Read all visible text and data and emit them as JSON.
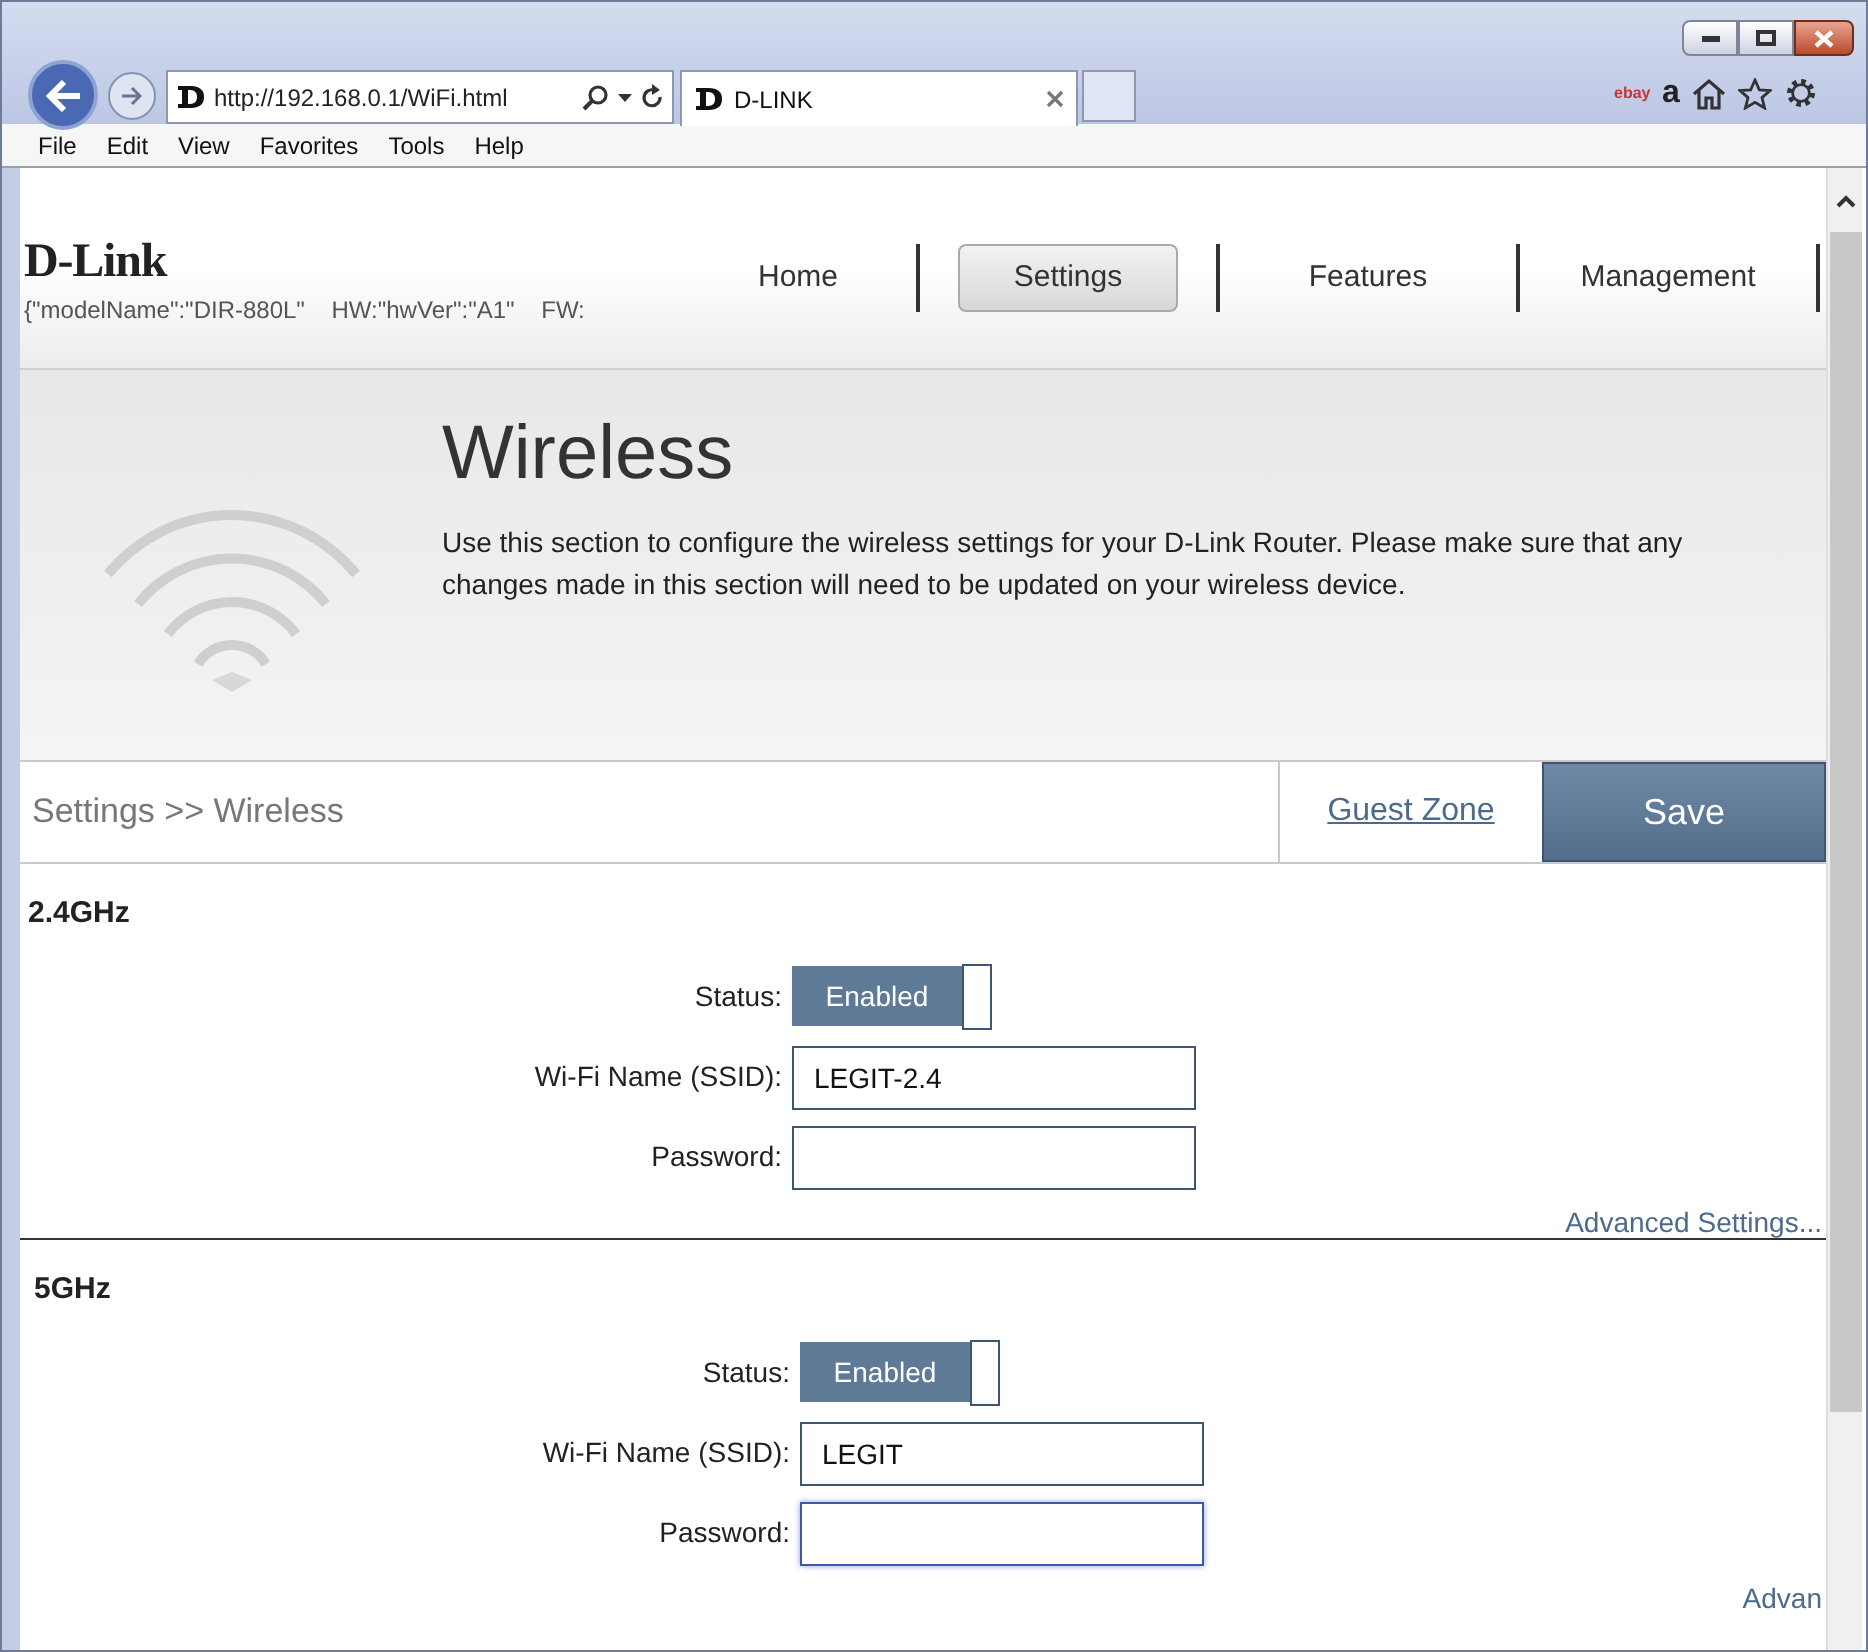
{
  "browser": {
    "address": "http://192.168.0.1/WiFi.html",
    "tabs": [
      {
        "title": "D-LINK",
        "selected": true
      }
    ],
    "menu": [
      "File",
      "Edit",
      "View",
      "Favorites",
      "Tools",
      "Help"
    ],
    "toolbar_icons": [
      {
        "kind": "ebay",
        "label": "ebay"
      },
      {
        "kind": "amazon",
        "label": "a"
      },
      {
        "kind": "home"
      },
      {
        "kind": "star"
      },
      {
        "kind": "gear"
      }
    ]
  },
  "header": {
    "logo": "D-Link",
    "model_info": "{\"modelName\":\"DIR-880L\"    HW:\"hwVer\":\"A1\"    FW:",
    "nav": [
      {
        "label": "Home",
        "selected": false
      },
      {
        "label": "Settings",
        "selected": true
      },
      {
        "label": "Features",
        "selected": false
      },
      {
        "label": "Management",
        "selected": false
      }
    ]
  },
  "banner": {
    "title": "Wireless",
    "description": "Use this section to configure the wireless settings for your D-Link Router. Please make sure that any changes made in this section will need to be updated on your wireless device."
  },
  "breadcrumb": "Settings >> Wireless",
  "guest_zone_link": "Guest Zone",
  "save_button": "Save",
  "sections": [
    {
      "title": "2.4GHz",
      "status_label": "Status:",
      "status": {
        "value": "Enabled",
        "on": true
      },
      "ssid_label": "Wi-Fi Name (SSID):",
      "ssid": "LEGIT-2.4",
      "password_label": "Password:",
      "password_focused": false,
      "advanced_link": "Advanced Settings..."
    },
    {
      "title": "5GHz",
      "status_label": "Status:",
      "status": {
        "value": "Enabled",
        "on": true
      },
      "ssid_label": "Wi-Fi Name (SSID):",
      "ssid": "LEGIT",
      "password_label": "Password:",
      "password_focused": true,
      "advanced_link": "Advan"
    }
  ]
}
